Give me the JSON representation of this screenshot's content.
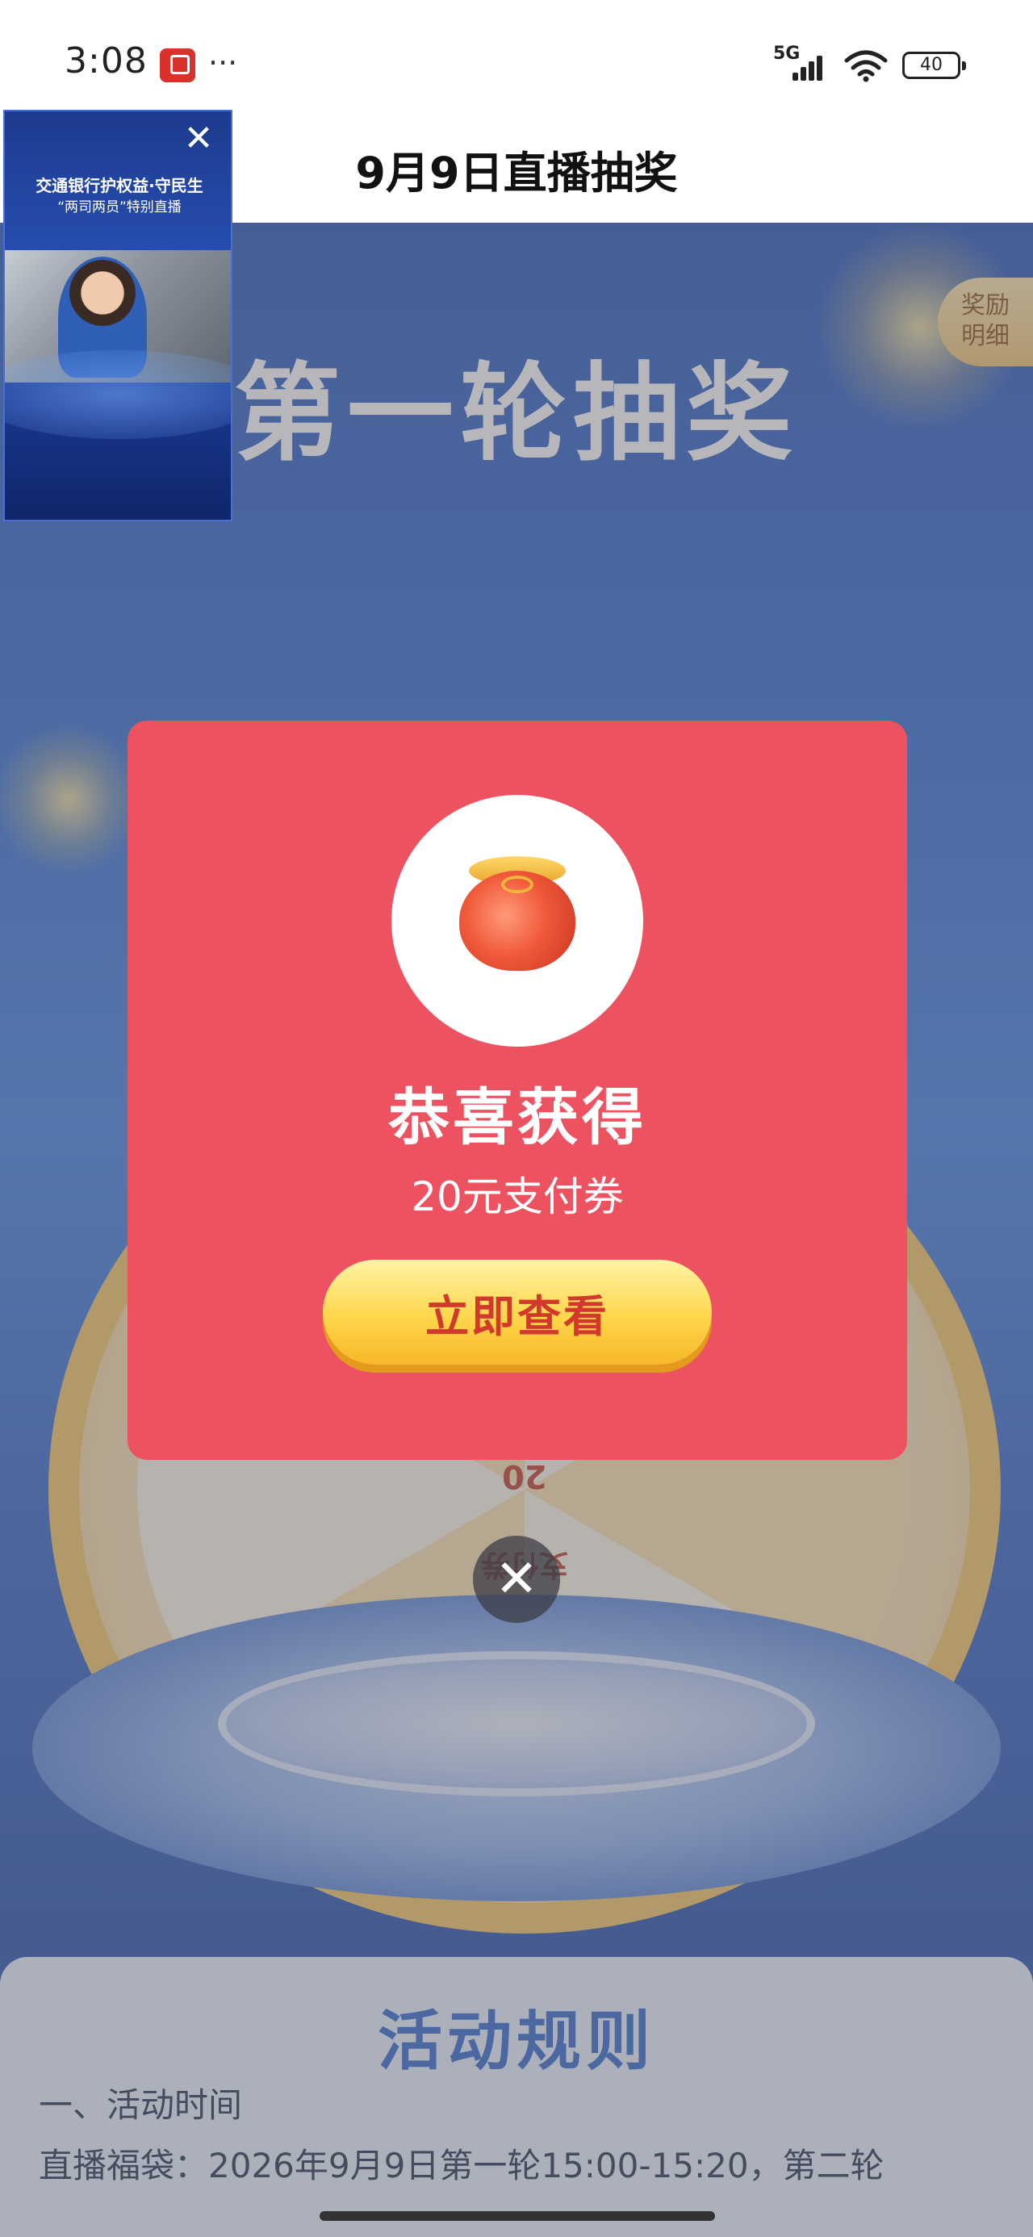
{
  "status_bar": {
    "time": "3:08",
    "network": "5G",
    "battery": "40",
    "more": "···"
  },
  "header": {
    "title": "9月9日直播抽奖"
  },
  "page": {
    "round_title": "第一轮抽奖",
    "reward_tab": [
      "奖励",
      "明细"
    ],
    "wheel_value": "20",
    "wheel_label": "支付券"
  },
  "live_video": {
    "headline": "交通银行护权益·守民生",
    "subline": "“两司两员”特别直播"
  },
  "modal": {
    "title": "恭喜获得",
    "prize": "20元支付券",
    "button": "立即查看",
    "close": "✕"
  },
  "rules": {
    "title": "活动规则",
    "section_1": "一、活动时间",
    "line_1": "直播福袋：2026年9月9日第一轮15:00-15:20，第二轮"
  },
  "colors": {
    "modal_bg": "#ec5260",
    "button_gold": "#ffd64b",
    "button_text": "#d0392b",
    "rules_title": "#2b63c9"
  }
}
